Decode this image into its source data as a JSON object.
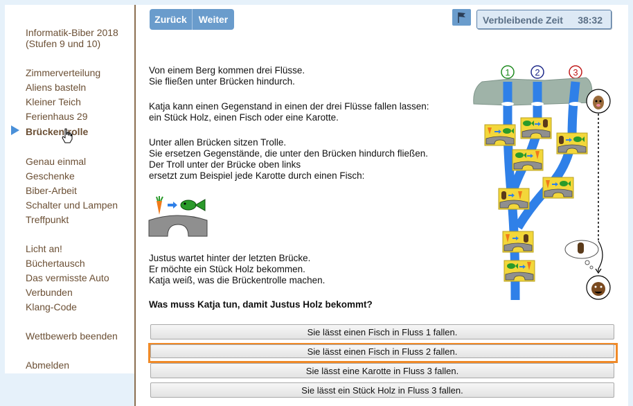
{
  "sidebar": {
    "contest_title_line1": "Informatik-Biber 2018",
    "contest_title_line2": "(Stufen 9 und 10)",
    "groups": [
      [
        "Zimmerverteilung",
        "Aliens basteln",
        "Kleiner Teich",
        "Ferienhaus 29",
        "Brückentrolle"
      ],
      [
        "Genau einmal",
        "Geschenke",
        "Biber-Arbeit",
        "Schalter und Lampen",
        "Treffpunkt"
      ],
      [
        "Licht an!",
        "Büchertausch",
        "Das vermisste Auto",
        "Verbunden",
        "Klang-Code"
      ]
    ],
    "active_item": "Brückentrolle",
    "end_contest": "Wettbewerb beenden",
    "logout": "Abmelden"
  },
  "toolbar": {
    "back_label": "Zurück",
    "next_label": "Weiter",
    "flag_icon": "flag-icon"
  },
  "timer": {
    "label": "Verbleibende Zeit",
    "value": "38:32"
  },
  "task": {
    "p1": [
      "Von einem Berg kommen drei Flüsse.",
      "Sie fließen unter Brücken hindurch."
    ],
    "p2": [
      "Katja kann einen Gegenstand in einen der drei Flüsse fallen lassen:",
      "ein Stück Holz, einen Fisch oder eine Karotte."
    ],
    "p3": [
      "Unter allen Brücken sitzen Trolle.",
      "Sie ersetzen Gegenstände, die unter den Brücken hindurch fließen.",
      "Der Troll unter der Brücke oben links",
      "ersetzt zum Beispiel jede Karotte durch einen Fisch:"
    ],
    "p4": [
      "Justus wartet hinter der letzten Brücke.",
      "Er möchte ein Stück Holz bekommen.",
      "Katja weiß, was die Brückentrolle machen."
    ],
    "question": "Was muss Katja tun, damit Justus Holz bekommt?",
    "river_numbers": [
      "1",
      "2",
      "3"
    ],
    "colors": {
      "river": "#2f80e8",
      "rock": "#9fb3a8",
      "bridge": "#8f8f8f",
      "box": "#f3d73a",
      "carrot": "#f07a1a",
      "fish": "#2a9a2a",
      "wood": "#5a3a1a"
    }
  },
  "answers": [
    "Sie lässt einen Fisch in Fluss 1 fallen.",
    "Sie lässt einen Fisch in Fluss 2 fallen.",
    "Sie lässt eine Karotte in Fluss 3 fallen.",
    "Sie lässt ein Stück Holz in Fluss 3 fallen."
  ],
  "selected_answer_index": 1,
  "colors": {
    "accent": "#6a9ccc",
    "highlight": "#f08a28",
    "sidebar_text": "#6b4f34"
  }
}
